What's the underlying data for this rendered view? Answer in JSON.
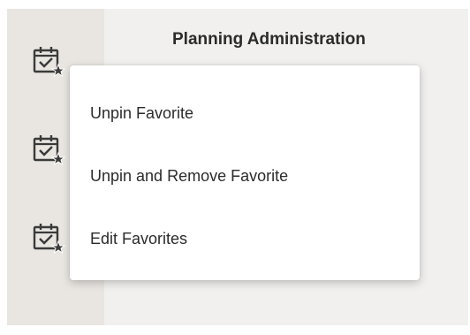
{
  "header": {
    "title": "Planning Administration"
  },
  "rail": {
    "items": [
      {
        "icon": "calendar-check-star-icon"
      },
      {
        "icon": "calendar-check-star-icon"
      },
      {
        "icon": "calendar-check-star-icon"
      }
    ]
  },
  "context_menu": {
    "items": [
      {
        "label": "Unpin Favorite"
      },
      {
        "label": "Unpin and Remove Favorite"
      },
      {
        "label": "Edit Favorites"
      }
    ]
  },
  "colors": {
    "rail_bg": "#e9e6e1",
    "content_bg": "#f2f0ee",
    "menu_bg": "#ffffff",
    "text": "#2b2b2b",
    "icon": "#3a3a3a"
  }
}
